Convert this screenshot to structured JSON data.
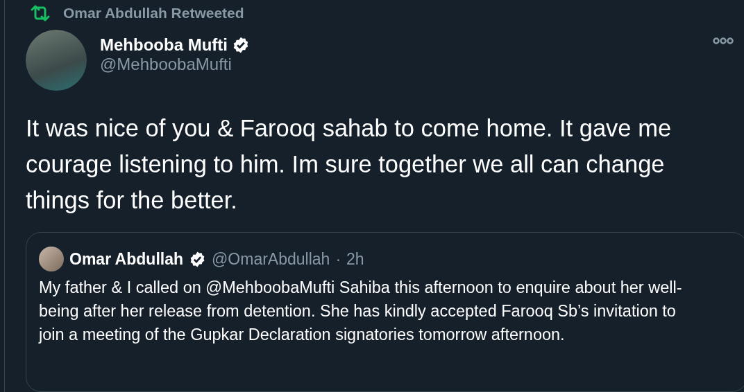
{
  "retweet": {
    "label": "Omar Abdullah Retweeted"
  },
  "tweet": {
    "name": "Mehbooba Mufti",
    "verified": true,
    "handle": "@MehboobaMufti",
    "text": "It was nice of you & Farooq sahab to come home. It gave me courage listening to him. Im sure together we all can change things for the better."
  },
  "quote": {
    "name": "Omar Abdullah",
    "verified": true,
    "handle": "@OmarAbdullah",
    "separator": "·",
    "time": "2h",
    "text": "My father & I called on @MehboobaMufti Sahiba this afternoon to enquire about her well-being after her release from detention. She has kindly accepted Farooq Sb’s invitation to join a meeting of the Gupkar Declaration signatories tomorrow afternoon."
  }
}
